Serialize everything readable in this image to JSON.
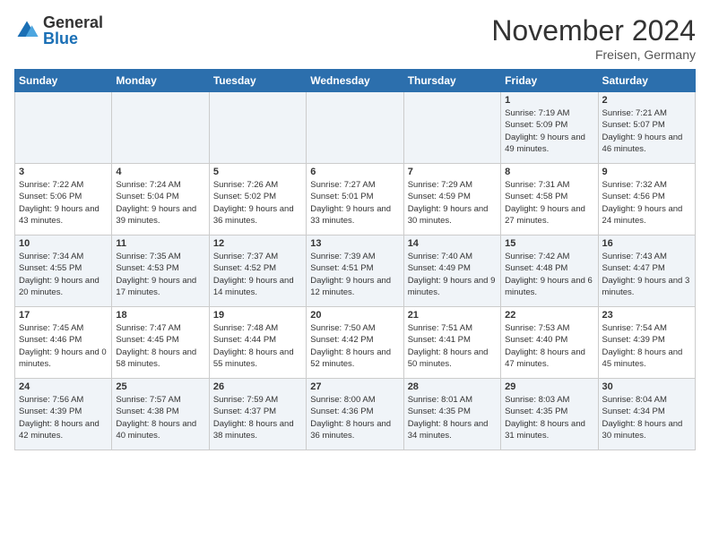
{
  "logo": {
    "general": "General",
    "blue": "Blue"
  },
  "title": "November 2024",
  "location": "Freisen, Germany",
  "days_of_week": [
    "Sunday",
    "Monday",
    "Tuesday",
    "Wednesday",
    "Thursday",
    "Friday",
    "Saturday"
  ],
  "weeks": [
    [
      {
        "day": "",
        "info": ""
      },
      {
        "day": "",
        "info": ""
      },
      {
        "day": "",
        "info": ""
      },
      {
        "day": "",
        "info": ""
      },
      {
        "day": "",
        "info": ""
      },
      {
        "day": "1",
        "info": "Sunrise: 7:19 AM\nSunset: 5:09 PM\nDaylight: 9 hours and 49 minutes."
      },
      {
        "day": "2",
        "info": "Sunrise: 7:21 AM\nSunset: 5:07 PM\nDaylight: 9 hours and 46 minutes."
      }
    ],
    [
      {
        "day": "3",
        "info": "Sunrise: 7:22 AM\nSunset: 5:06 PM\nDaylight: 9 hours and 43 minutes."
      },
      {
        "day": "4",
        "info": "Sunrise: 7:24 AM\nSunset: 5:04 PM\nDaylight: 9 hours and 39 minutes."
      },
      {
        "day": "5",
        "info": "Sunrise: 7:26 AM\nSunset: 5:02 PM\nDaylight: 9 hours and 36 minutes."
      },
      {
        "day": "6",
        "info": "Sunrise: 7:27 AM\nSunset: 5:01 PM\nDaylight: 9 hours and 33 minutes."
      },
      {
        "day": "7",
        "info": "Sunrise: 7:29 AM\nSunset: 4:59 PM\nDaylight: 9 hours and 30 minutes."
      },
      {
        "day": "8",
        "info": "Sunrise: 7:31 AM\nSunset: 4:58 PM\nDaylight: 9 hours and 27 minutes."
      },
      {
        "day": "9",
        "info": "Sunrise: 7:32 AM\nSunset: 4:56 PM\nDaylight: 9 hours and 24 minutes."
      }
    ],
    [
      {
        "day": "10",
        "info": "Sunrise: 7:34 AM\nSunset: 4:55 PM\nDaylight: 9 hours and 20 minutes."
      },
      {
        "day": "11",
        "info": "Sunrise: 7:35 AM\nSunset: 4:53 PM\nDaylight: 9 hours and 17 minutes."
      },
      {
        "day": "12",
        "info": "Sunrise: 7:37 AM\nSunset: 4:52 PM\nDaylight: 9 hours and 14 minutes."
      },
      {
        "day": "13",
        "info": "Sunrise: 7:39 AM\nSunset: 4:51 PM\nDaylight: 9 hours and 12 minutes."
      },
      {
        "day": "14",
        "info": "Sunrise: 7:40 AM\nSunset: 4:49 PM\nDaylight: 9 hours and 9 minutes."
      },
      {
        "day": "15",
        "info": "Sunrise: 7:42 AM\nSunset: 4:48 PM\nDaylight: 9 hours and 6 minutes."
      },
      {
        "day": "16",
        "info": "Sunrise: 7:43 AM\nSunset: 4:47 PM\nDaylight: 9 hours and 3 minutes."
      }
    ],
    [
      {
        "day": "17",
        "info": "Sunrise: 7:45 AM\nSunset: 4:46 PM\nDaylight: 9 hours and 0 minutes."
      },
      {
        "day": "18",
        "info": "Sunrise: 7:47 AM\nSunset: 4:45 PM\nDaylight: 8 hours and 58 minutes."
      },
      {
        "day": "19",
        "info": "Sunrise: 7:48 AM\nSunset: 4:44 PM\nDaylight: 8 hours and 55 minutes."
      },
      {
        "day": "20",
        "info": "Sunrise: 7:50 AM\nSunset: 4:42 PM\nDaylight: 8 hours and 52 minutes."
      },
      {
        "day": "21",
        "info": "Sunrise: 7:51 AM\nSunset: 4:41 PM\nDaylight: 8 hours and 50 minutes."
      },
      {
        "day": "22",
        "info": "Sunrise: 7:53 AM\nSunset: 4:40 PM\nDaylight: 8 hours and 47 minutes."
      },
      {
        "day": "23",
        "info": "Sunrise: 7:54 AM\nSunset: 4:39 PM\nDaylight: 8 hours and 45 minutes."
      }
    ],
    [
      {
        "day": "24",
        "info": "Sunrise: 7:56 AM\nSunset: 4:39 PM\nDaylight: 8 hours and 42 minutes."
      },
      {
        "day": "25",
        "info": "Sunrise: 7:57 AM\nSunset: 4:38 PM\nDaylight: 8 hours and 40 minutes."
      },
      {
        "day": "26",
        "info": "Sunrise: 7:59 AM\nSunset: 4:37 PM\nDaylight: 8 hours and 38 minutes."
      },
      {
        "day": "27",
        "info": "Sunrise: 8:00 AM\nSunset: 4:36 PM\nDaylight: 8 hours and 36 minutes."
      },
      {
        "day": "28",
        "info": "Sunrise: 8:01 AM\nSunset: 4:35 PM\nDaylight: 8 hours and 34 minutes."
      },
      {
        "day": "29",
        "info": "Sunrise: 8:03 AM\nSunset: 4:35 PM\nDaylight: 8 hours and 31 minutes."
      },
      {
        "day": "30",
        "info": "Sunrise: 8:04 AM\nSunset: 4:34 PM\nDaylight: 8 hours and 30 minutes."
      }
    ]
  ]
}
